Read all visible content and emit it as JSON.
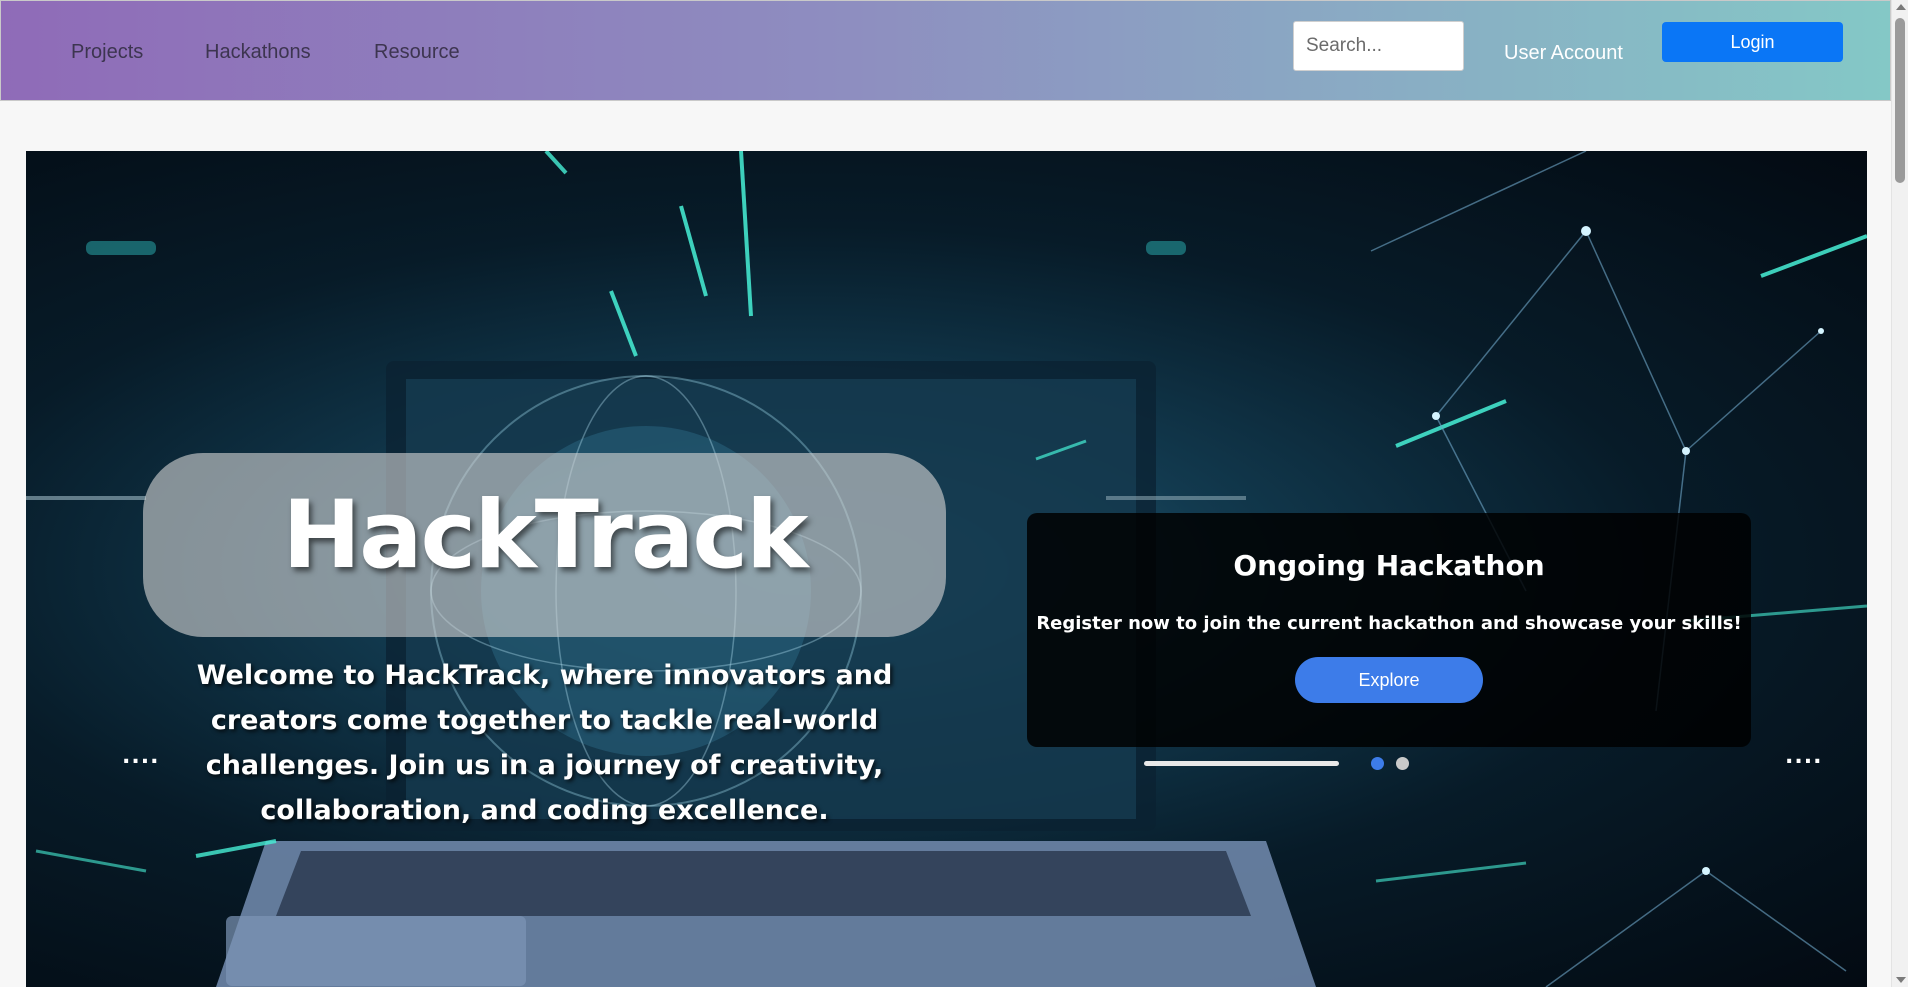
{
  "nav": {
    "links": [
      "Projects",
      "Hackathons",
      "Resource"
    ],
    "search_placeholder": "Search...",
    "user_account": "User Account",
    "login_label": "Login",
    "colors": {
      "gradient_start": "#8f6bb8",
      "gradient_end": "#84c8c6",
      "login_bg": "#0a76f6"
    }
  },
  "hero": {
    "title": "HackTrack",
    "welcome": "Welcome to HackTrack, where innovators and creators come together to tackle real-world challenges. Join us in a journey of creativity, collaboration, and coding excellence.",
    "card": {
      "title": "Ongoing Hackathon",
      "text": "Register now to join the current hackathon and showcase your skills!",
      "button_label": "Explore"
    },
    "carousel": {
      "slide_count": 2,
      "active_index": 0
    },
    "ellipsis": "....",
    "colors": {
      "accent": "#3d7ce9"
    }
  }
}
